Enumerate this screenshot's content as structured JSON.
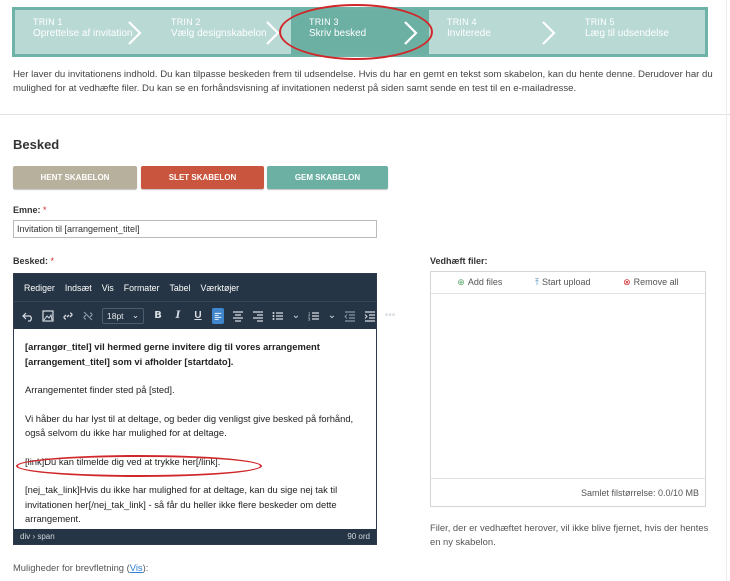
{
  "steps": [
    {
      "num": "TRIN 1",
      "label": "Oprettelse af invitation",
      "active": false
    },
    {
      "num": "TRIN 2",
      "label": "Vælg designskabelon",
      "active": false
    },
    {
      "num": "TRIN 3",
      "label": "Skriv besked",
      "active": true
    },
    {
      "num": "TRIN 4",
      "label": "Inviterede",
      "active": false
    },
    {
      "num": "TRIN 5",
      "label": "Læg til udsendelse",
      "active": false
    }
  ],
  "intro": "Her laver du invitationens indhold. Du kan tilpasse beskeden frem til udsendelse. Hvis du har en gemt en tekst som skabelon, kan du hente denne. Derudover har du mulighed for at vedhæfte filer. Du kan se en forhåndsvisning af invitationen nederst på siden samt sende en test til en e-mailadresse.",
  "section_title": "Besked",
  "buttons": {
    "hent": "HENT SKABELON",
    "slet": "SLET SKABELON",
    "gem": "GEM SKABELON"
  },
  "emne": {
    "label": "Emne:",
    "required": "*",
    "value": "Invitation til [arrangement_titel]"
  },
  "besked": {
    "label": "Besked:",
    "required": "*"
  },
  "editor": {
    "menu": [
      "Rediger",
      "Indsæt",
      "Vis",
      "Formater",
      "Tabel",
      "Værktøjer"
    ],
    "font_size": "18pt",
    "paragraphs": [
      {
        "text": "[arrangør_titel] vil hermed gerne invitere dig til vores arrangement [arrangement_titel] som vi afholder [startdato].",
        "bold": true
      },
      {
        "text": "Arrangementet finder sted på [sted].",
        "bold": false
      },
      {
        "text": "Vi håber du har lyst til at deltage, og beder dig venligst give besked på forhånd, også selvom du ikke har mulighed for at deltage.",
        "bold": false
      },
      {
        "text": "[link]Du kan tilmelde dig ved at trykke her[/link].",
        "bold": false
      },
      {
        "text": "[nej_tak_link]Hvis du ikke har mulighed for at deltage, kan du sige nej tak til invitationen her[/nej_tak_link] - så får du heller ikke flere beskeder om dette arrangement.",
        "bold": false
      }
    ],
    "path": "div › span",
    "word_count": "90 ord"
  },
  "mulig": {
    "text": "Muligheder for brevfletning (",
    "link": "Vis",
    "close": "):"
  },
  "attach": {
    "label": "Vedhæft filer:",
    "add": "Add files",
    "upload": "Start upload",
    "remove": "Remove all",
    "size": "Samlet filstørrelse: 0.0/10 MB",
    "note": "Filer, der er vedhæftet herover, vil ikke blive fjernet, hvis der hentes en ny skabelon."
  },
  "colors": {
    "accent": "#6cb0a4",
    "danger": "#c9553e",
    "neutral": "#b7b09c",
    "editor_bg": "#263545",
    "highlight": "#d0282a"
  }
}
